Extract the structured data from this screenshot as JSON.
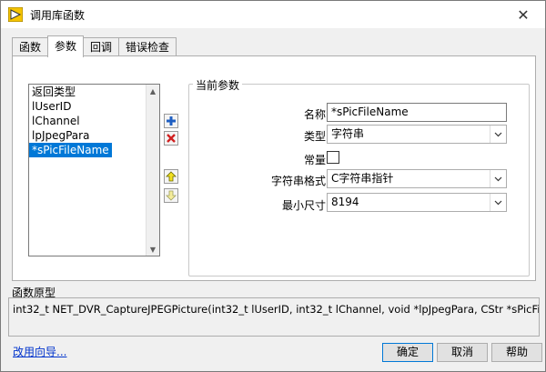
{
  "window": {
    "title": "调用库函数",
    "close_glyph": "✕"
  },
  "tabs": [
    {
      "label": "函数",
      "active": false
    },
    {
      "label": "参数",
      "active": true
    },
    {
      "label": "回调",
      "active": false
    },
    {
      "label": "错误检查",
      "active": false
    }
  ],
  "param_list": {
    "items": [
      "返回类型",
      "lUserID",
      "lChannel",
      "lpJpegPara",
      "*sPicFileName"
    ],
    "selected_index": 4
  },
  "current_params": {
    "title": "当前参数",
    "name_label": "名称",
    "name_value": "*sPicFileName",
    "type_label": "类型",
    "type_value": "字符串",
    "constant_label": "常量",
    "constant_checked": false,
    "string_format_label": "字符串格式",
    "string_format_value": "C字符串指针",
    "min_size_label": "最小尺寸",
    "min_size_value": "8194"
  },
  "prototype": {
    "label": "函数原型",
    "text": "int32_t NET_DVR_CaptureJPEGPicture(int32_t lUserID, int32_t lChannel, void *lpJpegPara, CStr *sPicFileName);"
  },
  "footer": {
    "help_link": "改用向导...",
    "ok_label": "确定",
    "cancel_label": "取消",
    "help_label": "帮助"
  },
  "colors": {
    "selection": "#0078d7",
    "add_icon": "#1f5fc2",
    "delete_icon": "#d02020",
    "move_icon": "#e0c020",
    "link": "#0033cc"
  }
}
